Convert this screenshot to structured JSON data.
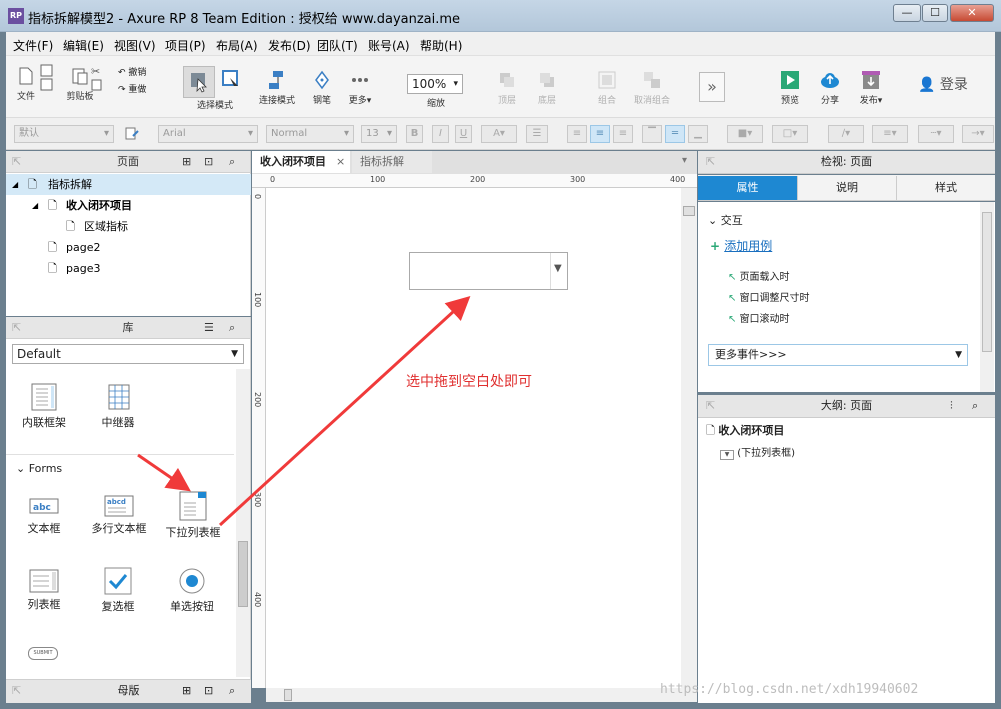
{
  "window": {
    "title": "指标拆解模型2 - Axure RP 8 Team Edition : 授权给 www.dayanzai.me",
    "icon_text": "RP",
    "controls": [
      "—",
      "☐",
      "✕"
    ]
  },
  "menu": [
    "文件(F)",
    "编辑(E)",
    "视图(V)",
    "项目(P)",
    "布局(A)",
    "发布(D)",
    "团队(T)",
    "账号(A)",
    "帮助(H)"
  ],
  "toolbar": {
    "file": "文件",
    "clipboard": "剪贴板",
    "cut_label": "撤销",
    "redo_label": "重做",
    "select_mode": "选择模式",
    "connect_mode": "连接模式",
    "pen": "钢笔",
    "more": "更多▾",
    "zoom_value": "100%",
    "zoom_label": "缩放",
    "top": "顶层",
    "bottom": "底层",
    "group": "组合",
    "ungroup": "取消组合",
    "preview": "预览",
    "share": "分享",
    "publish": "发布▾",
    "login": "登录"
  },
  "format": {
    "style": "默认",
    "font": "Arial",
    "weight": "Normal",
    "size": "13"
  },
  "pages_panel": {
    "title": "页面",
    "items": [
      {
        "label": "指标拆解",
        "level": 0
      },
      {
        "label": "收入闭环项目",
        "level": 1
      },
      {
        "label": "区域指标",
        "level": 2
      },
      {
        "label": "page2",
        "level": 1
      },
      {
        "label": "page3",
        "level": 1
      }
    ]
  },
  "library_panel": {
    "title": "库",
    "selected": "Default",
    "top_items": [
      "内联框架",
      "中继器"
    ],
    "forms_header": "Forms",
    "forms_items": [
      "文本框",
      "多行文本框",
      "下拉列表框",
      "列表框",
      "复选框",
      "单选按钮"
    ],
    "submit": "SUBMIT"
  },
  "masters_panel": {
    "title": "母版"
  },
  "canvas": {
    "tabs": [
      "收入闭环项目",
      "指标拆解"
    ],
    "ruler_h": [
      "0",
      "100",
      "200",
      "300",
      "400"
    ],
    "ruler_v": [
      "0",
      "100",
      "200",
      "300",
      "400"
    ],
    "annotation": "选中拖到空白处即可",
    "watermark": "https://blog.csdn.net/xdh19940602"
  },
  "inspector": {
    "title": "检视: 页面",
    "tabs": [
      "属性",
      "说明",
      "样式"
    ],
    "section": "交互",
    "add_case": "添加用例",
    "events": [
      "页面载入时",
      "窗口调整尺寸时",
      "窗口滚动时"
    ],
    "more_events": "更多事件>>>"
  },
  "outline": {
    "title": "大纲: 页面",
    "page": "收入闭环项目",
    "item": "(下拉列表框)"
  },
  "colors": {
    "accent": "#1e88d2",
    "arrow": "#f03a3a",
    "selection": "#d4e9f7"
  }
}
